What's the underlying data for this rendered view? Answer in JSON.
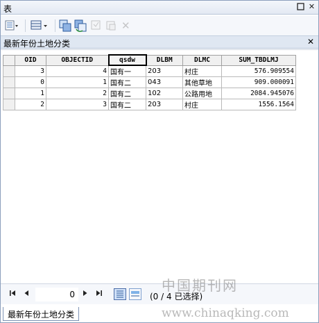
{
  "window": {
    "title": "表"
  },
  "table_tab": {
    "label": "最新年份土地分类"
  },
  "grid": {
    "columns": [
      "OID",
      "OBJECTID",
      "qsdw",
      "DLBM",
      "DLMC",
      "SUM_TBDLMJ"
    ],
    "rows": [
      [
        "3",
        "4",
        "国有一",
        "203",
        "村庄",
        "576.909554"
      ],
      [
        "0",
        "1",
        "国有二",
        "043",
        "其他草地",
        "909.000091"
      ],
      [
        "1",
        "2",
        "国有二",
        "102",
        "公路用地",
        "2084.945076"
      ],
      [
        "2",
        "3",
        "国有二",
        "203",
        "村庄",
        "1556.1564"
      ]
    ]
  },
  "navigation": {
    "current_record": "0",
    "selection_text": "(0 / 4 已选择)"
  },
  "bottom_tab": {
    "label": "最新年份土地分类"
  },
  "watermark": {
    "line1": "中国期刊网",
    "line2": "www.chinaqking.com"
  }
}
